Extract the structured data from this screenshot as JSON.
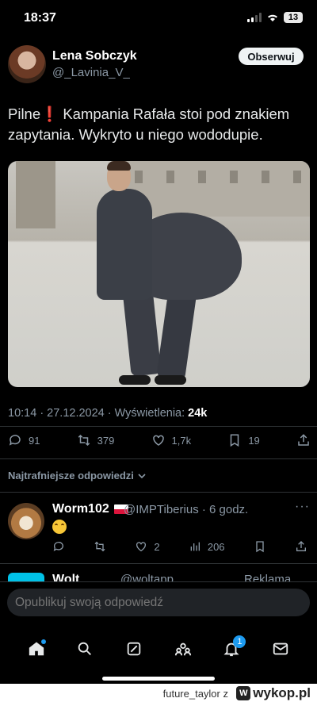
{
  "status_bar": {
    "time": "18:37",
    "battery": "13"
  },
  "tweet": {
    "author_name": "Lena Sobczyk",
    "author_handle": "@_Lavinia_V_",
    "follow_label": "Obserwuj",
    "text_prefix": "Pilne",
    "text_body": " Kampania Rafała stoi pod znakiem zapytania. Wykryto u niego wododupie.",
    "meta_time": "10:14 · 27.12.2024 · Wyświetlenia: ",
    "meta_views": "24k"
  },
  "actions": {
    "replies": "91",
    "retweets": "379",
    "likes": "1,7k",
    "bookmarks": "19"
  },
  "sort_label": "Najtrafniejsze odpowiedzi",
  "reply": {
    "name": "Worm102",
    "handle": "@IMPTiberius · 6 godz.",
    "more": "···",
    "likes": "2",
    "views": "206"
  },
  "ad": {
    "name": "Wolt",
    "handle": "@woltapp",
    "label": "Reklama"
  },
  "composer": {
    "placeholder": "Opublikuj swoją odpowiedź"
  },
  "tabbar": {
    "notifications_badge": "1"
  },
  "footer": {
    "user": "future_taylor",
    "separator": "z",
    "brand": "wykop.pl"
  },
  "colors": {
    "accent": "#1d9bf0",
    "background": "#000000",
    "muted": "#8b98a5"
  }
}
